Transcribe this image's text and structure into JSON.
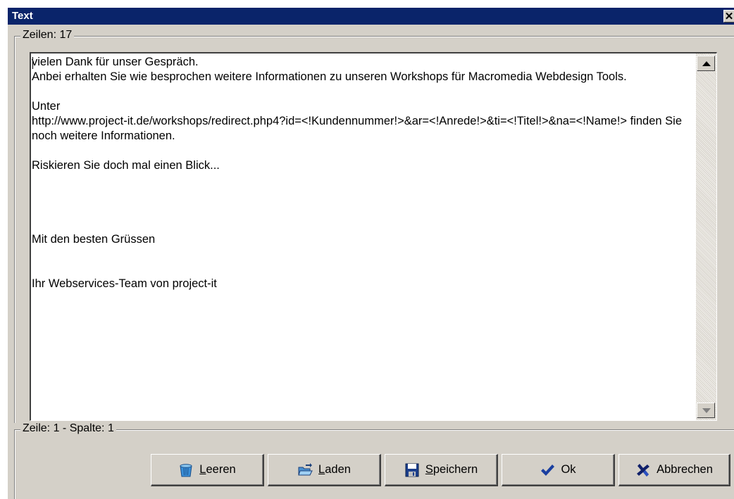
{
  "window": {
    "title": "Text",
    "close_glyph": "✕"
  },
  "group_top": {
    "legend": "Zeilen: 17"
  },
  "group_bottom": {
    "legend": "Zeile: 1 - Spalte: 1"
  },
  "editor": {
    "text": "vielen Dank für unser Gespräch.\nAnbei erhalten Sie wie besprochen weitere Informationen zu unseren Workshops für Macromedia Webdesign Tools.\n\nUnter\nhttp://www.project-it.de/workshops/redirect.php4?id=<!Kundennummer!>&ar=<!Anrede!>&ti=<!Titel!>&na=<!Name!> finden Sie noch weitere Informationen.\n\nRiskieren Sie doch mal einen Blick...\n\n\n\n\nMit den besten Grüssen\n\n\nIhr Webservices-Team von project-it"
  },
  "buttons": {
    "clear": {
      "label_mnemonic": "L",
      "label_rest": "eeren",
      "icon": "trash-bin-icon"
    },
    "load": {
      "label_mnemonic": "L",
      "label_rest": "aden",
      "icon": "open-folder-icon"
    },
    "save": {
      "label_mnemonic": "S",
      "label_rest": "peichern",
      "icon": "floppy-disk-icon"
    },
    "ok": {
      "label": "Ok",
      "icon": "checkmark-icon"
    },
    "cancel": {
      "label": "Abbrechen",
      "icon": "cross-icon"
    }
  },
  "colors": {
    "titlebar": "#0a246a",
    "face": "#d4d0c8"
  }
}
